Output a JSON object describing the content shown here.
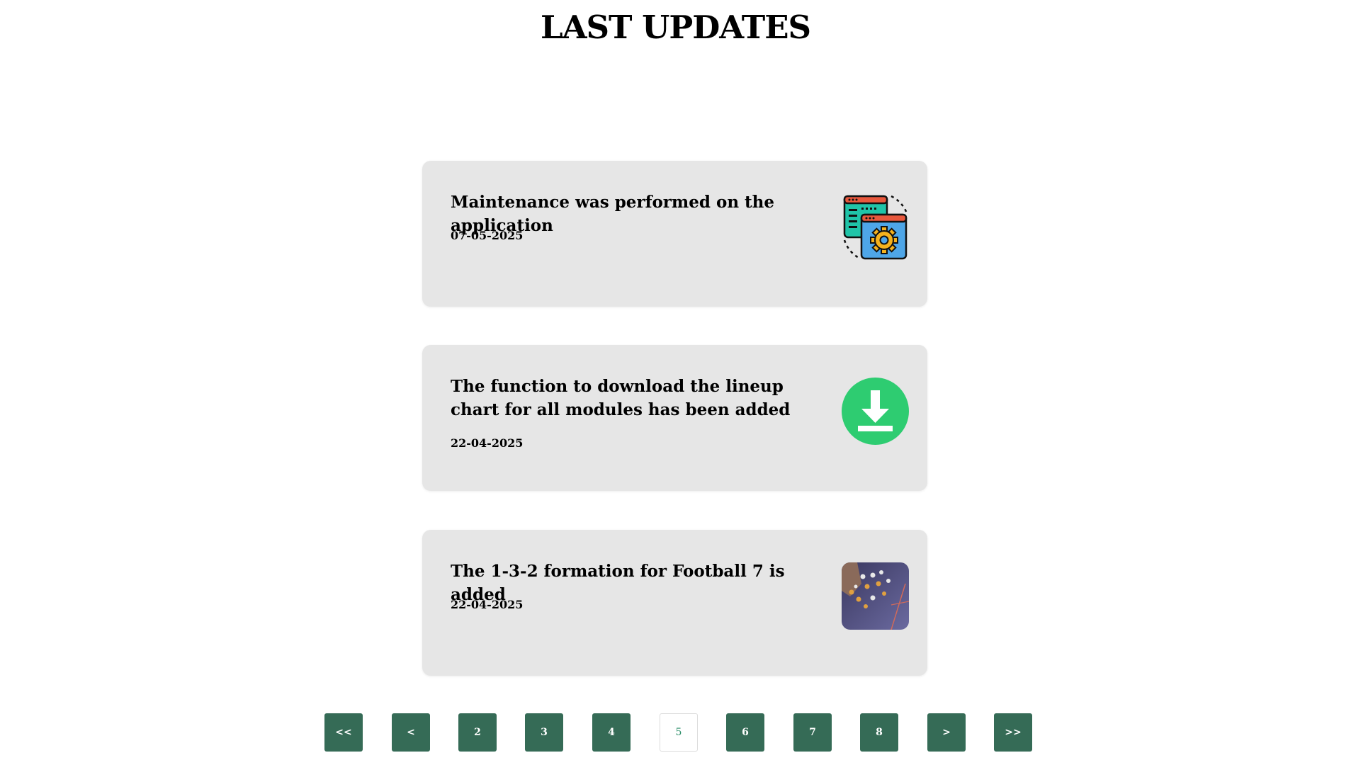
{
  "header": {
    "title": "LAST UPDATES"
  },
  "updates": [
    {
      "title": "Maintenance was performed on the application",
      "date": "07-05-2025",
      "icon": "settings-windows-icon"
    },
    {
      "title": "The function to download the lineup chart for all modules has been added",
      "date": "22-04-2025",
      "icon": "download-icon"
    },
    {
      "title": "The 1-3-2 formation for Football 7 is added",
      "date": "22-04-2025",
      "icon": "tactics-board-image"
    }
  ],
  "pagination": {
    "first": "<<",
    "prev": "<",
    "pages": [
      "2",
      "3",
      "4",
      "5",
      "6",
      "7",
      "8"
    ],
    "current": "5",
    "next": ">",
    "last": ">>"
  },
  "colors": {
    "card_background": "#e6e6e6",
    "pagination_button": "#356b56",
    "current_page_text": "#2e8f6a",
    "download_green": "#2ecc71"
  }
}
